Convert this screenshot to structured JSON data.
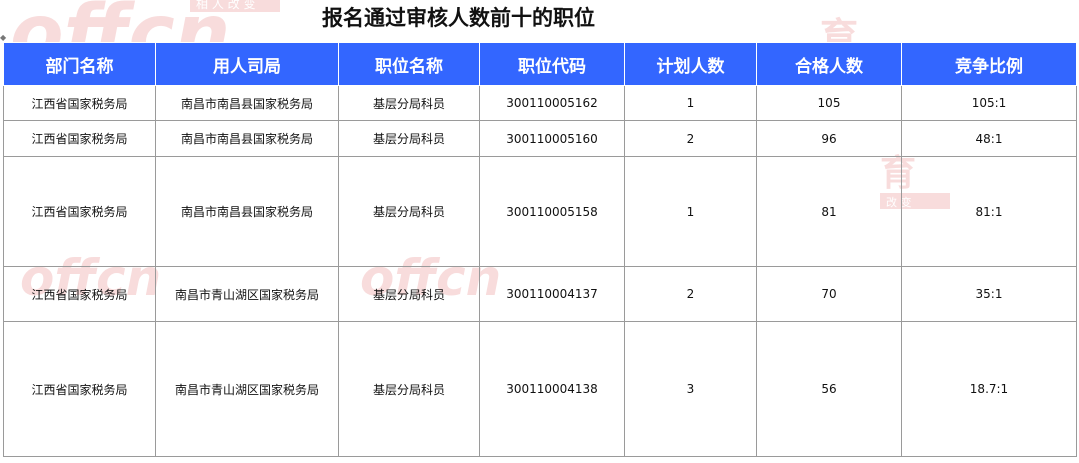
{
  "page": {
    "title": "报名通过审核人数前十的职位"
  },
  "watermark": {
    "brand": "offcn",
    "motto": "相 人 改 变",
    "chars": "育",
    "color": "#d62d2d"
  },
  "table": {
    "header_color": "#3366ff",
    "columns": [
      "部门名称",
      "用人司局",
      "职位名称",
      "职位代码",
      "计划人数",
      "合格人数",
      "竞争比例"
    ],
    "rows": [
      [
        "江西省国家税务局",
        "南昌市南昌县国家税务局",
        "基层分局科员",
        "300110005162",
        "1",
        "105",
        "105:1"
      ],
      [
        "江西省国家税务局",
        "南昌市南昌县国家税务局",
        "基层分局科员",
        "300110005160",
        "2",
        "96",
        "48:1"
      ],
      [
        "江西省国家税务局",
        "南昌市南昌县国家税务局",
        "基层分局科员",
        "300110005158",
        "1",
        "81",
        "81:1"
      ],
      [
        "江西省国家税务局",
        "南昌市青山湖区国家税务局",
        "基层分局科员",
        "300110004137",
        "2",
        "70",
        "35:1"
      ],
      [
        "江西省国家税务局",
        "南昌市青山湖区国家税务局",
        "基层分局科员",
        "300110004138",
        "3",
        "56",
        "18.7:1"
      ]
    ]
  }
}
